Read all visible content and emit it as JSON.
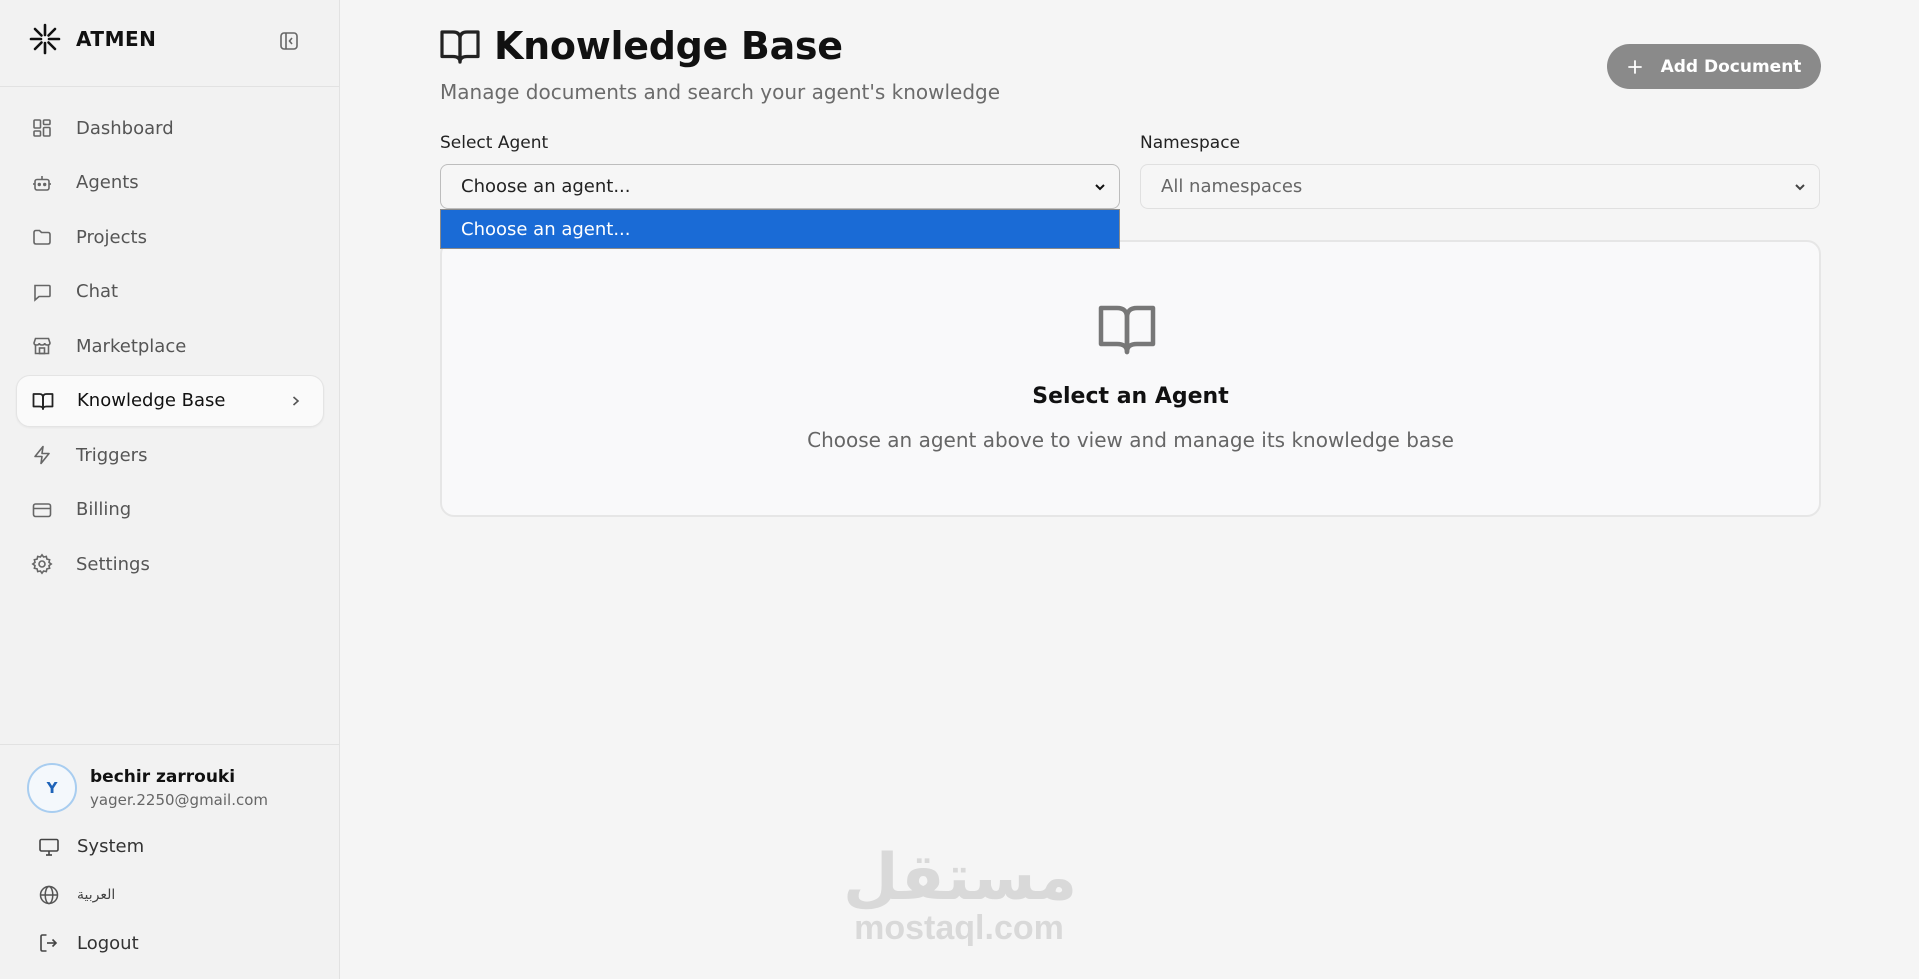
{
  "sidebar": {
    "brand_name": "ATMEN",
    "items": [
      {
        "label": "Dashboard",
        "icon": "dashboard-grid-icon"
      },
      {
        "label": "Agents",
        "icon": "bot-icon"
      },
      {
        "label": "Projects",
        "icon": "folder-icon"
      },
      {
        "label": "Chat",
        "icon": "chat-bubble-icon"
      },
      {
        "label": "Marketplace",
        "icon": "store-icon"
      },
      {
        "label": "Knowledge Base",
        "icon": "book-open-icon",
        "active": true
      },
      {
        "label": "Triggers",
        "icon": "lightning-icon"
      },
      {
        "label": "Billing",
        "icon": "credit-card-icon"
      },
      {
        "label": "Settings",
        "icon": "gear-icon"
      }
    ],
    "user": {
      "initial": "Y",
      "name": "bechir zarrouki",
      "email": "yager.2250@gmail.com"
    },
    "footer": {
      "theme_label": "System",
      "language_label": "العربية",
      "logout_label": "Logout"
    }
  },
  "header": {
    "title": "Knowledge Base",
    "subtitle": "Manage documents and search your agent's knowledge",
    "add_document_label": "Add Document"
  },
  "filters": {
    "agent_label": "Select Agent",
    "agent_value": "Choose an agent...",
    "agent_options": [
      "Choose an agent..."
    ],
    "namespace_label": "Namespace",
    "namespace_value": "All namespaces"
  },
  "empty_state": {
    "title": "Select an Agent",
    "description": "Choose an agent above to view and manage its knowledge base"
  },
  "watermark": {
    "logo_text": "مستقل",
    "url": "mostaql.com"
  },
  "colors": {
    "accent_selected_option": "#1a6bd6",
    "add_button_bg": "#8a8a8a",
    "avatar_border": "#a8cdf0",
    "background": "#f5f5f5"
  }
}
